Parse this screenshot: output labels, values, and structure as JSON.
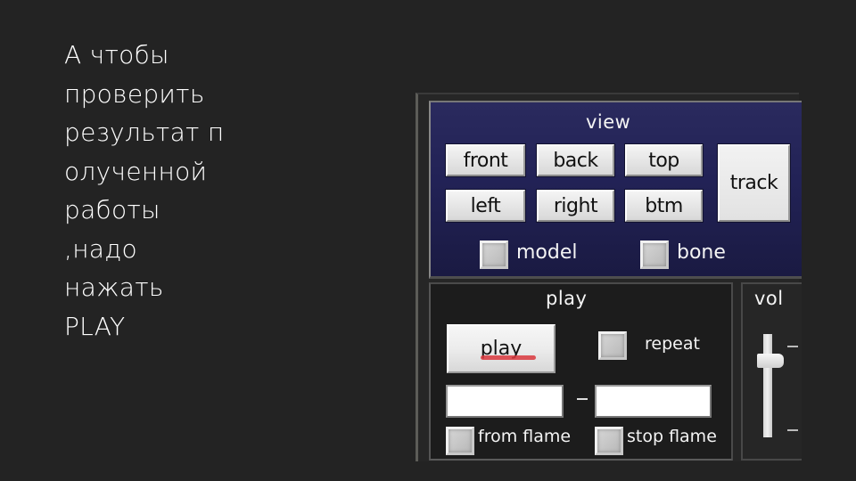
{
  "slide": {
    "lines": [
      "А чтобы",
      "проверить",
      "результат п",
      "олученной",
      "работы",
      ",надо",
      "нажать",
      "PLAY"
    ]
  },
  "app": {
    "view_panel": {
      "title": "view",
      "buttons": {
        "front": "front",
        "back": "back",
        "top": "top",
        "left": "left",
        "right": "right",
        "btm": "btm",
        "track": "track"
      },
      "checkboxes": {
        "model": {
          "label": "model",
          "checked": false
        },
        "bone": {
          "label": "bone",
          "checked": false
        }
      },
      "background_color": "#222256"
    },
    "play_panel": {
      "title": "play",
      "play_button": "play",
      "annotation_underline_color": "#d9373d",
      "repeat": {
        "label": "repeat",
        "checked": false
      },
      "from_frame_value": "",
      "to_frame_value": "",
      "separator": "–",
      "from_flame": {
        "label": "from flame",
        "checked": false
      },
      "stop_flame": {
        "label": "stop flame",
        "checked": false
      }
    },
    "vol_panel": {
      "title": "vol",
      "volume_level": 0.78
    }
  }
}
